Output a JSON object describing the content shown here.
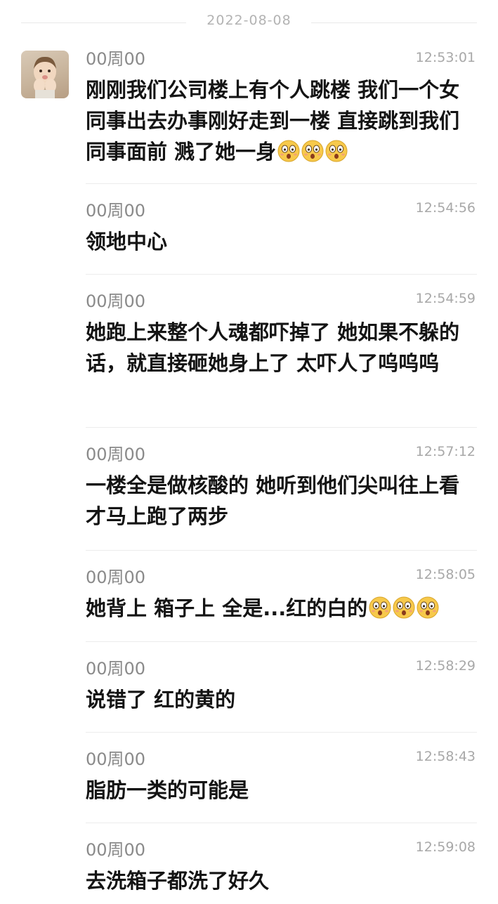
{
  "date_divider": "2022-08-08",
  "messages": [
    {
      "sender": "00周00",
      "time": "12:53:01",
      "text": "刚刚我们公司楼上有个人跳楼 我们一个女同事出去办事刚好走到一楼 直接跳到我们同事面前 溅了她一身",
      "emoji": [
        "shocked-emoji",
        "shocked-emoji",
        "shocked-emoji"
      ]
    },
    {
      "sender": "00周00",
      "time": "12:54:56",
      "text": "领地中心",
      "emoji": []
    },
    {
      "sender": "00周00",
      "time": "12:54:59",
      "text": "她跑上来整个人魂都吓掉了 她如果不躲的话，就直接砸她身上了 太吓人了呜呜呜",
      "emoji": []
    },
    {
      "sender": "00周00",
      "time": "12:57:12",
      "text": "一楼全是做核酸的 她听到他们尖叫往上看 才马上跑了两步",
      "emoji": []
    },
    {
      "sender": "00周00",
      "time": "12:58:05",
      "text": "她背上 箱子上 全是...红的白的",
      "emoji": [
        "shocked-emoji",
        "shocked-emoji",
        "shocked-emoji"
      ]
    },
    {
      "sender": "00周00",
      "time": "12:58:29",
      "text": "说错了 红的黄的",
      "emoji": []
    },
    {
      "sender": "00周00",
      "time": "12:58:43",
      "text": "脂肪一类的可能是",
      "emoji": []
    },
    {
      "sender": "00周00",
      "time": "12:59:08",
      "text": "去洗箱子都洗了好久",
      "emoji": []
    }
  ]
}
